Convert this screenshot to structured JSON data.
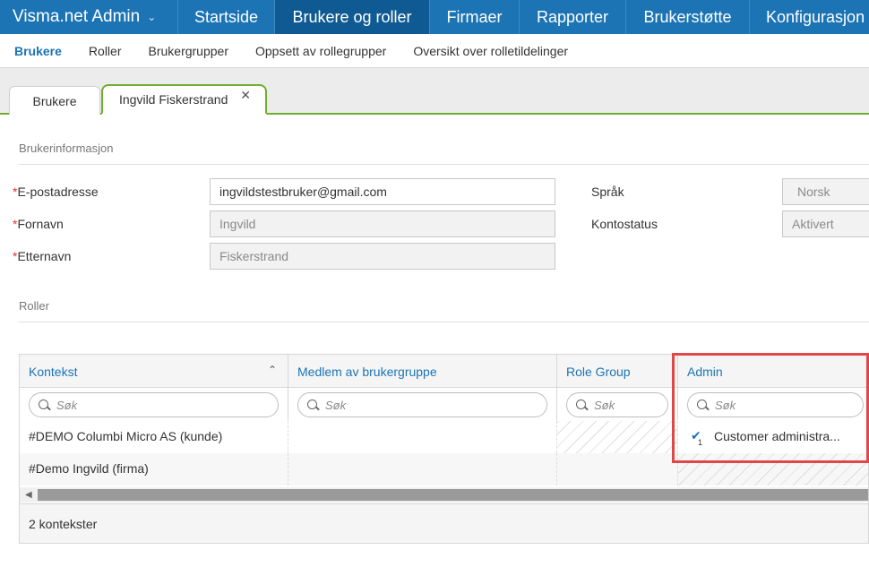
{
  "topnav": {
    "brand": "Visma.net Admin",
    "items": [
      "Startside",
      "Brukere og roller",
      "Firmaer",
      "Rapporter",
      "Brukerstøtte",
      "Konfigurasjon"
    ],
    "active_index": 1
  },
  "subnav": {
    "items": [
      "Brukere",
      "Roller",
      "Brukergrupper",
      "Oppsett av rollegrupper",
      "Oversikt over rolletildelinger"
    ],
    "active_index": 0
  },
  "tabs": {
    "tab1": "Brukere",
    "tab2": "Ingvild Fiskerstrand"
  },
  "user_info": {
    "section_title": "Brukerinformasjon",
    "email_label": "E-postadresse",
    "email_value": "ingvildstestbruker@gmail.com",
    "firstname_label": "Fornavn",
    "firstname_value": "Ingvild",
    "lastname_label": "Etternavn",
    "lastname_value": "Fiskerstrand",
    "language_label": "Språk",
    "language_value": "Norsk",
    "account_status_label": "Kontostatus",
    "account_status_value": "Aktivert",
    "required_mark": "*"
  },
  "roles": {
    "section_title": "Roller",
    "columns": [
      "Kontekst",
      "Medlem av brukergruppe",
      "Role Group",
      "Admin"
    ],
    "search_placeholder": "Søk",
    "rows": [
      {
        "context": "#DEMO Columbi Micro AS (kunde)",
        "group": "",
        "role_group": "",
        "admin": "Customer administra...",
        "admin_count": "1"
      },
      {
        "context": "#Demo Ingvild (firma)",
        "group": "",
        "role_group": "",
        "admin": "",
        "admin_count": ""
      }
    ],
    "footer": "2 kontekster"
  },
  "colors": {
    "nav_blue": "#1c74b5",
    "tab_green": "#6fae2e",
    "highlight_red": "#e04848"
  }
}
